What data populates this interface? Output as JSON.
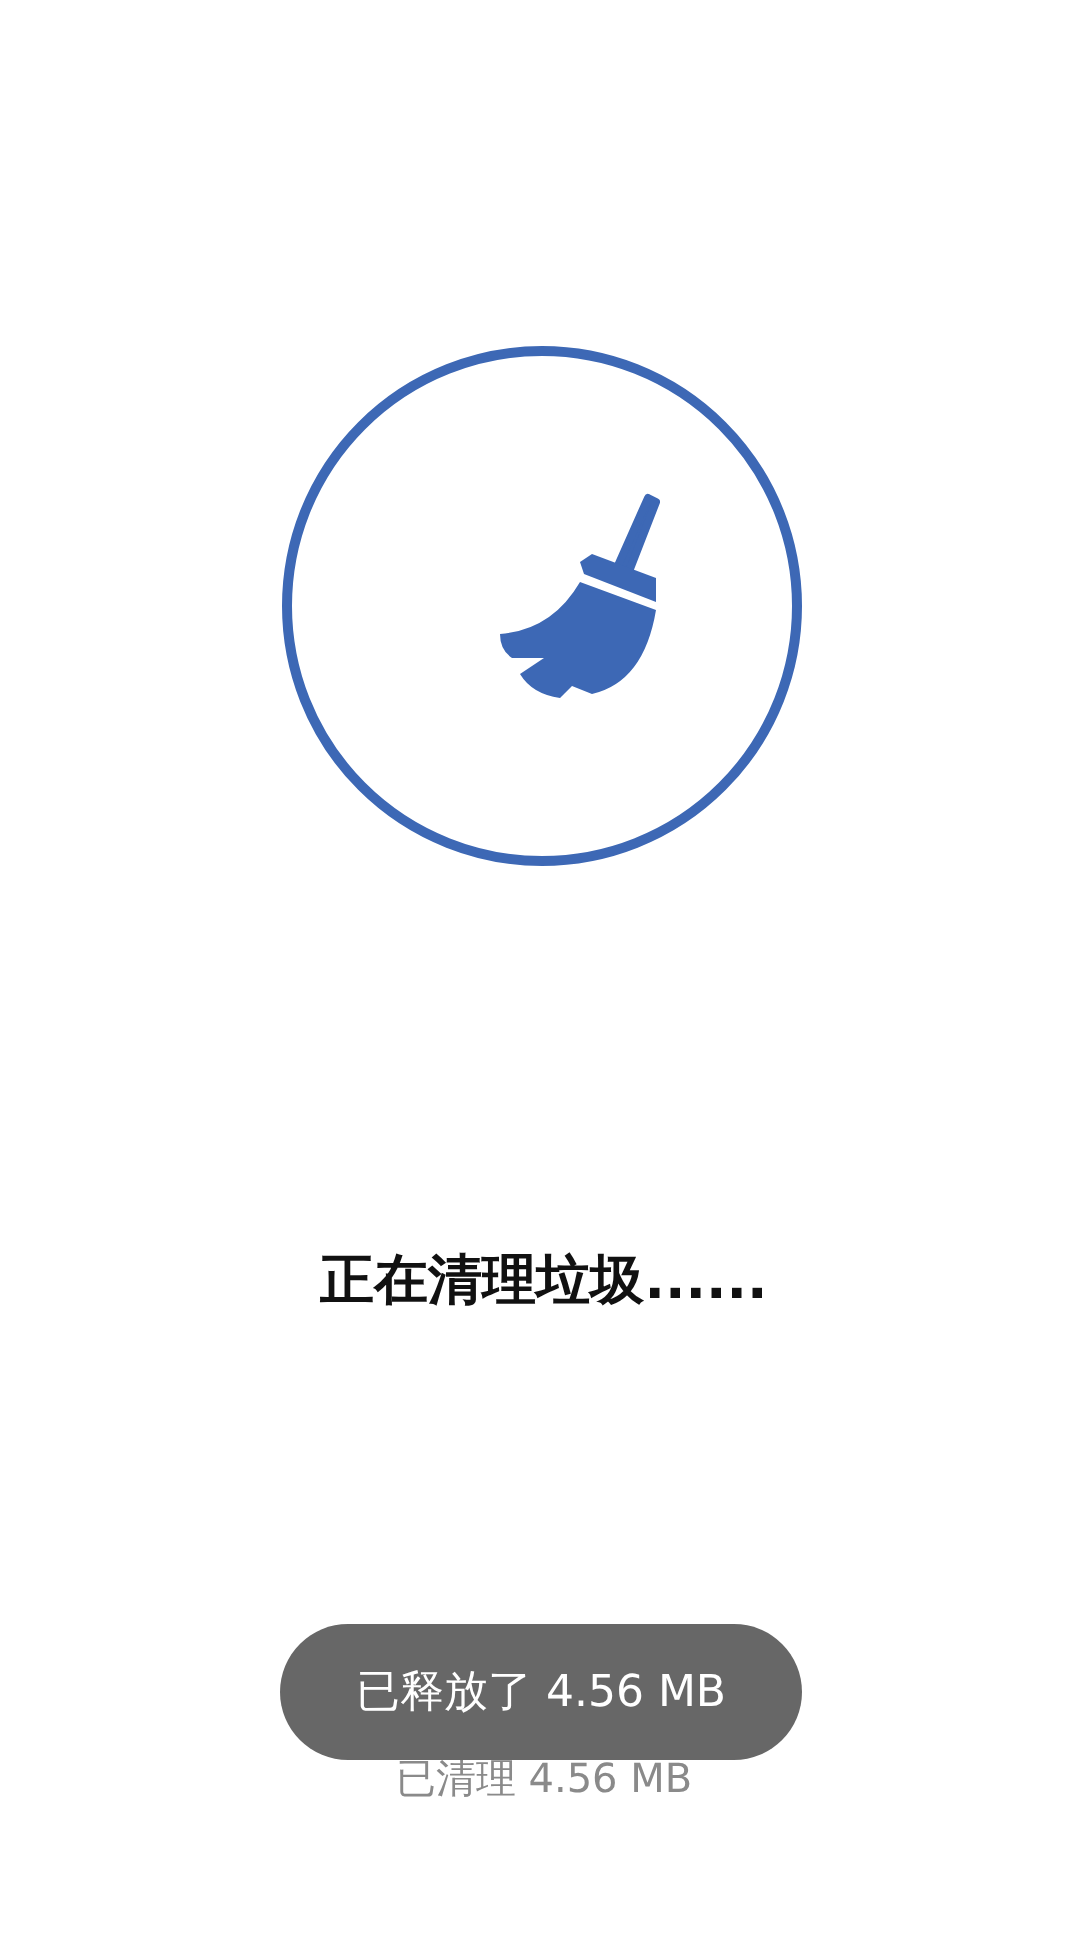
{
  "status": {
    "title": "正在清理垃圾......",
    "cleaned": "已清理 4.56 MB"
  },
  "toast": {
    "message": "已释放了 4.56 MB"
  }
}
